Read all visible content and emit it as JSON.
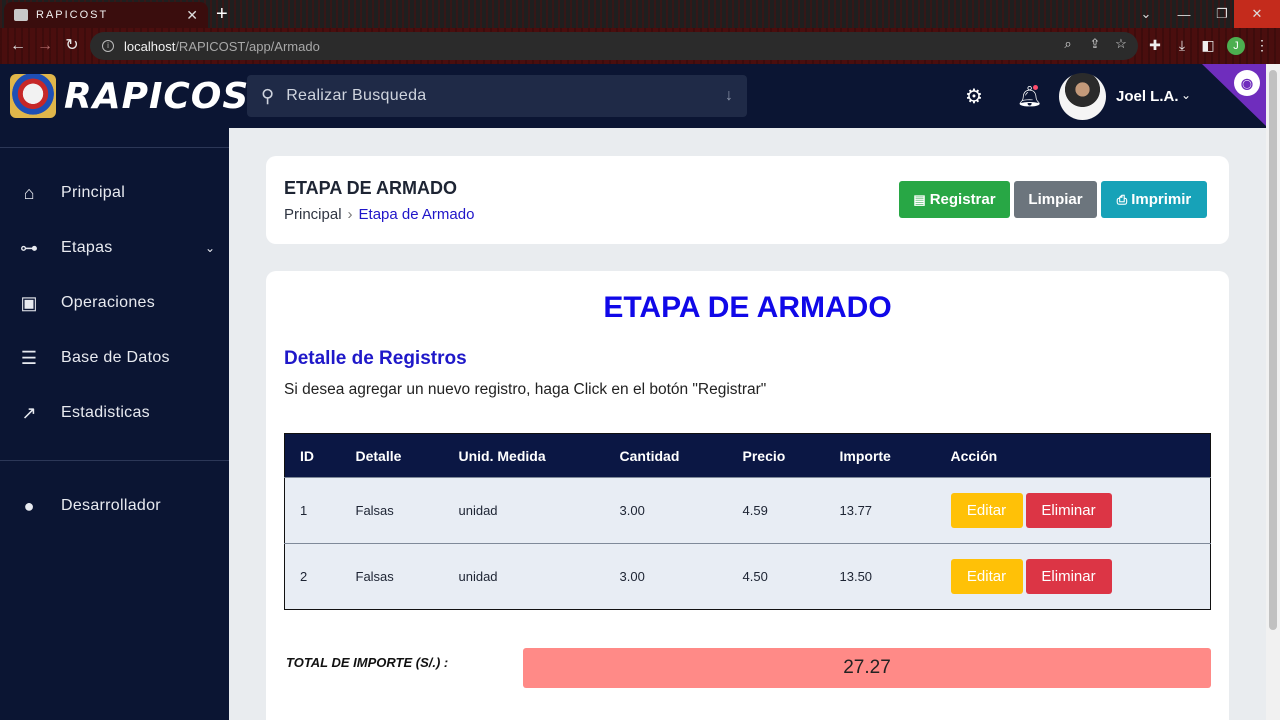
{
  "browser": {
    "tab_title": "RAPICOST",
    "tab_close": "✕",
    "new_tab": "+",
    "url_host": "localhost",
    "url_path": "/RAPICOST/app/Armado",
    "profile_initial": "J"
  },
  "header": {
    "logo_text": "RAPICOST",
    "search_placeholder": "Realizar Busqueda",
    "user_name": "Joel L.A."
  },
  "sidebar": {
    "items": [
      {
        "label": "Principal",
        "icon": "home-icon"
      },
      {
        "label": "Etapas",
        "icon": "sitemap-icon"
      },
      {
        "label": "Operaciones",
        "icon": "money-icon"
      },
      {
        "label": "Base de Datos",
        "icon": "database-icon"
      },
      {
        "label": "Estadisticas",
        "icon": "chart-line-icon"
      }
    ],
    "developer": "Desarrollador"
  },
  "page": {
    "title": "ETAPA DE ARMADO",
    "breadcrumb": [
      "Principal",
      "Etapa de Armado"
    ],
    "buttons": {
      "register": "Registrar",
      "clear": "Limpiar",
      "print": "Imprimir"
    },
    "big_title": "ETAPA DE ARMADO",
    "section_title": "Detalle de Registros",
    "helper": "Si desea agregar un nuevo registro, haga Click en el botón \"Registrar\""
  },
  "table": {
    "headers": [
      "ID",
      "Detalle",
      "Unid. Medida",
      "Cantidad",
      "Precio",
      "Importe",
      "Acción"
    ],
    "rows": [
      {
        "id": "1",
        "detalle": "Falsas",
        "unidad": "unidad",
        "cantidad": "3.00",
        "precio": "4.59",
        "importe": "13.77"
      },
      {
        "id": "2",
        "detalle": "Falsas",
        "unidad": "unidad",
        "cantidad": "3.00",
        "precio": "4.50",
        "importe": "13.50"
      }
    ],
    "edit_label": "Editar",
    "delete_label": "Eliminar"
  },
  "total": {
    "label": "TOTAL DE IMPORTE (S/.) :",
    "value": "27.27"
  },
  "colors": {
    "header_bg": "#0b1533",
    "accent_title": "#1008e8",
    "register_btn": "#28a745",
    "clear_btn": "#6c757d",
    "print_btn": "#17a2b8",
    "edit_btn": "#ffc107",
    "delete_btn": "#dc3545",
    "total_bg": "#ff8a87"
  }
}
